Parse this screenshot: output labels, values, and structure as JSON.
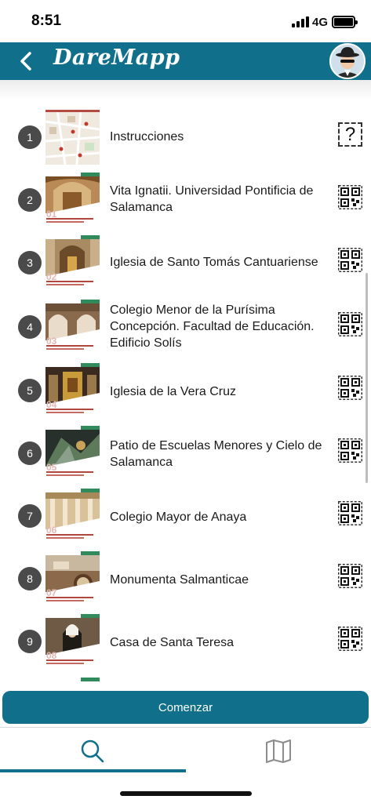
{
  "status_bar": {
    "time": "8:51",
    "network": "4G"
  },
  "header": {
    "logo_text": "DareMapp",
    "accent_color": "#106f8a"
  },
  "items": [
    {
      "number": "1",
      "title": "Instrucciones",
      "action_icon": "help-icon"
    },
    {
      "number": "2",
      "title": "Vita Ignatii. Universidad Pontificia de Salamanca",
      "action_icon": "qr-code-icon",
      "thumb_number": "01"
    },
    {
      "number": "3",
      "title": "Iglesia de Santo Tomás Cantuariense",
      "action_icon": "qr-code-icon",
      "thumb_number": "02"
    },
    {
      "number": "4",
      "title": "Colegio Menor de la Purísima Concepción. Facultad de Educación. Edificio Solís",
      "action_icon": "qr-code-icon",
      "thumb_number": "03"
    },
    {
      "number": "5",
      "title": "Iglesia de la Vera Cruz",
      "action_icon": "qr-code-icon",
      "thumb_number": "04"
    },
    {
      "number": "6",
      "title": "Patio de Escuelas Menores y Cielo de Salamanca",
      "action_icon": "qr-code-icon",
      "thumb_number": "05"
    },
    {
      "number": "7",
      "title": "Colegio Mayor de Anaya",
      "action_icon": "qr-code-icon",
      "thumb_number": "06"
    },
    {
      "number": "8",
      "title": "Monumenta Salmanticae",
      "action_icon": "qr-code-icon",
      "thumb_number": "07"
    },
    {
      "number": "9",
      "title": "Casa de Santa Teresa",
      "action_icon": "qr-code-icon",
      "thumb_number": "08"
    }
  ],
  "start_button": {
    "label": "Comenzar"
  },
  "tabs": [
    {
      "icon": "search-icon",
      "active": true
    },
    {
      "icon": "map-icon",
      "active": false
    }
  ]
}
